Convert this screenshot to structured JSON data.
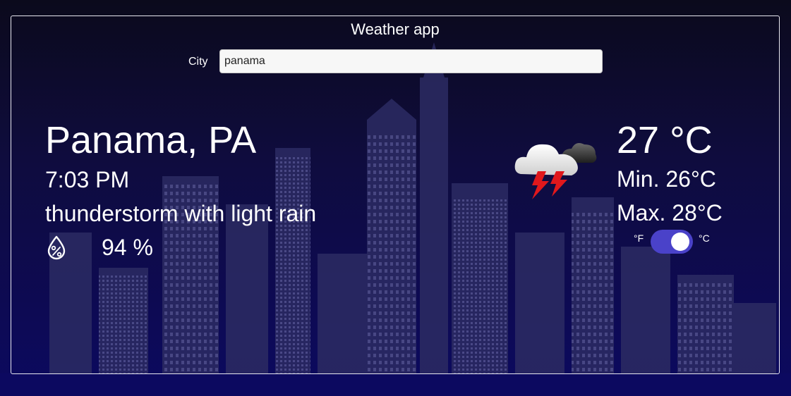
{
  "app": {
    "title": "Weather app"
  },
  "search": {
    "label": "City",
    "value": "panama",
    "placeholder": ""
  },
  "weather": {
    "location": "Panama, PA",
    "time": "7:03 PM",
    "description": "thunderstorm with light rain",
    "humidity": "94 %",
    "icon": "thunderstorm-cloud-icon",
    "temperature": "27 °C",
    "min": "Min. 26°C",
    "max": "Max. 28°C"
  },
  "units": {
    "fahrenheit_label": "°F",
    "celsius_label": "°C",
    "celsius_selected": true
  },
  "colors": {
    "background_top": "#0b0a1c",
    "background_bottom": "#0c0960",
    "toggle_accent": "#4a42c9",
    "text": "#ffffff"
  }
}
